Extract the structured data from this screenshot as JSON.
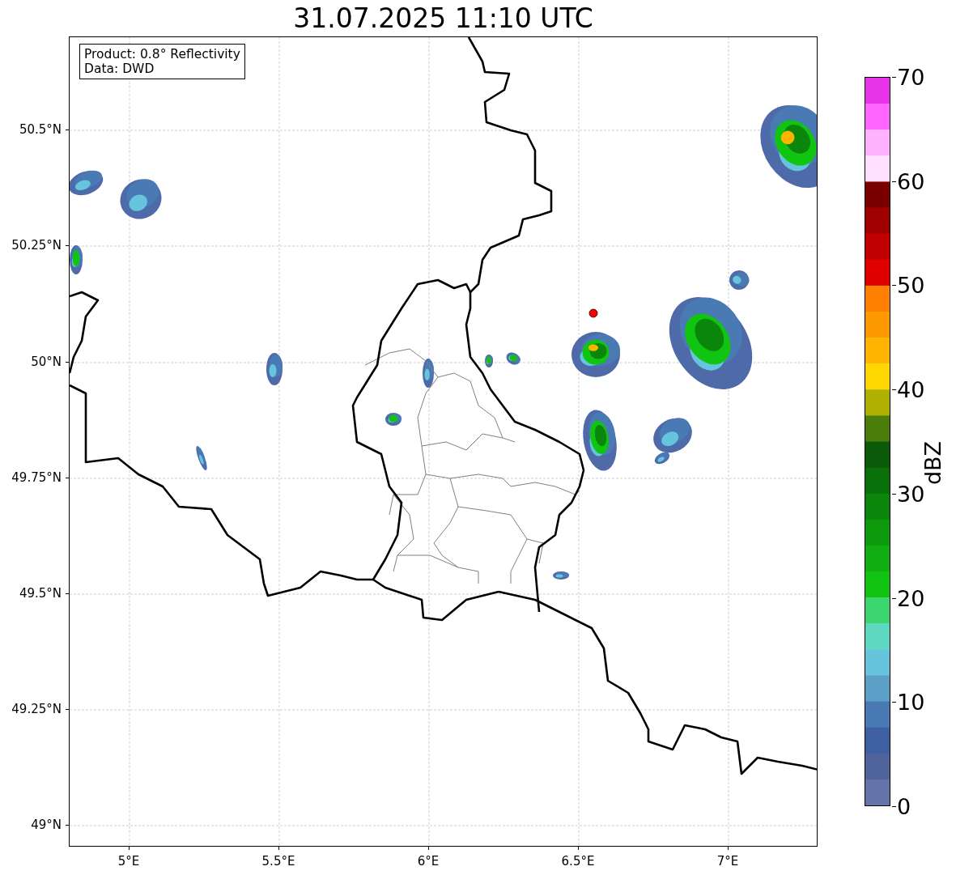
{
  "title": "31.07.2025 11:10 UTC",
  "legend": {
    "lines": [
      "Product: 0.8° Reflectivity",
      "Data: DWD"
    ]
  },
  "map": {
    "x_ticks": [
      "5°E",
      "5.5°E",
      "6°E",
      "6.5°E",
      "7°E"
    ],
    "y_ticks": [
      "50.5°N",
      "50.25°N",
      "50°N",
      "49.75°N",
      "49.5°N",
      "49.25°N",
      "49°N"
    ]
  },
  "colorbar": {
    "label": "dBZ",
    "ticks": [
      "70",
      "60",
      "50",
      "40",
      "30",
      "20",
      "10",
      "0"
    ]
  }
}
